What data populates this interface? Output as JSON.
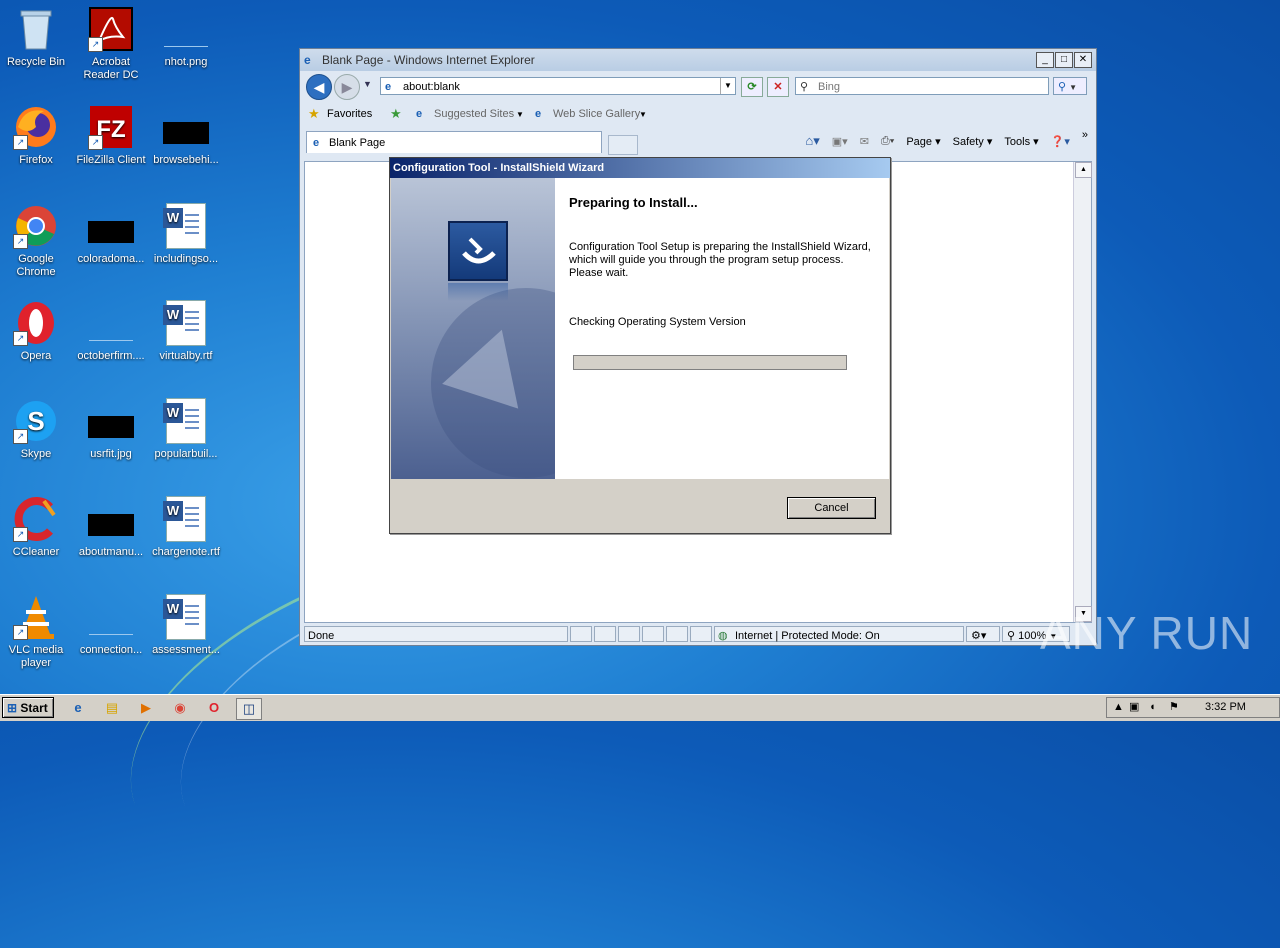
{
  "desktop": {
    "icons": [
      {
        "label": "Recycle Bin"
      },
      {
        "label": "Acrobat Reader DC"
      },
      {
        "label": "nhot.png"
      },
      {
        "label": "Firefox"
      },
      {
        "label": "FileZilla Client"
      },
      {
        "label": "browsebehi..."
      },
      {
        "label": "Google Chrome"
      },
      {
        "label": "coloradoma..."
      },
      {
        "label": "includingso..."
      },
      {
        "label": "Opera"
      },
      {
        "label": "octoberfirm...."
      },
      {
        "label": "virtualby.rtf"
      },
      {
        "label": "Skype"
      },
      {
        "label": "usrfit.jpg"
      },
      {
        "label": "popularbuil..."
      },
      {
        "label": "CCleaner"
      },
      {
        "label": "aboutmanu..."
      },
      {
        "label": "chargenote.rtf"
      },
      {
        "label": "VLC media player"
      },
      {
        "label": "connection..."
      },
      {
        "label": "assessment..."
      }
    ]
  },
  "ie": {
    "title": "Blank Page - Windows Internet Explorer",
    "address": "about:blank",
    "search_placeholder": "Bing",
    "favorites_label": "Favorites",
    "suggested_sites": "Suggested Sites",
    "web_slice_gallery": "Web Slice Gallery",
    "tab_label": "Blank Page",
    "cmd_page": "Page",
    "cmd_safety": "Safety",
    "cmd_tools": "Tools",
    "status_text": "Done",
    "zone_text": "Internet | Protected Mode: On",
    "zoom": "100%"
  },
  "dialog": {
    "title": "Configuration Tool - InstallShield Wizard",
    "heading": "Preparing to Install...",
    "body": "Configuration Tool Setup is preparing the InstallShield Wizard, which will guide you through the program setup process. Please wait.",
    "status": "Checking Operating System Version",
    "progress": 0,
    "cancel_label": "Cancel"
  },
  "taskbar": {
    "start_label": "Start",
    "clock": "3:32 PM"
  },
  "watermark": "ANY RUN"
}
